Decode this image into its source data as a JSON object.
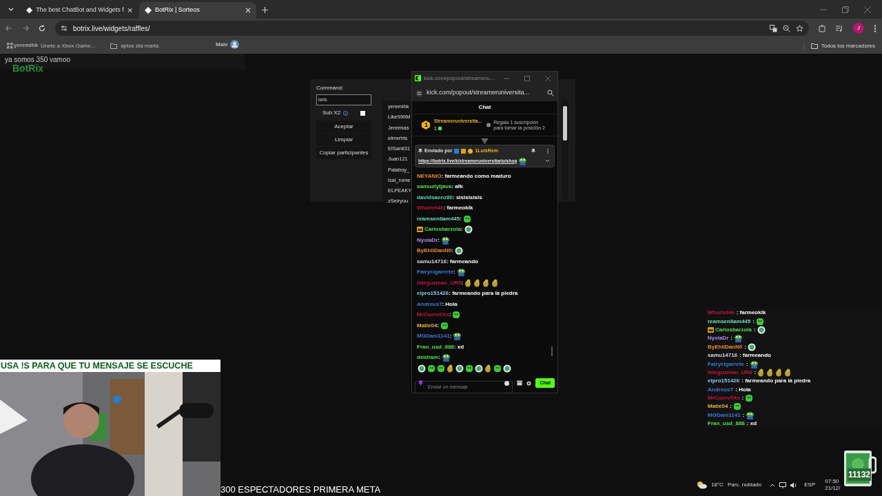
{
  "browser": {
    "tabs": [
      {
        "title": "The best ChatBot and Widgets f",
        "selected": false
      },
      {
        "title": "BotRix | Sorteos",
        "selected": true
      }
    ],
    "url": "botrix.live/widgets/raffles/",
    "profile_initial": "J",
    "bookmarks": [
      "Únete a Xbox Game...",
      "aptos sta marta"
    ],
    "all_bookmarks": "Todos los marcadores"
  },
  "stream_overlay": {
    "alert_user": "yeremihk",
    "alert_name": "Male",
    "chat_line": "ya somos 350 vamoo",
    "logo": "BotRix"
  },
  "raffle": {
    "command_label": "Command:",
    "command_value": "laris",
    "option": {
      "label": "Sub X2",
      "checked": false
    },
    "buttons": [
      "Aceptar",
      "Limpiar",
      "Copiar participantes"
    ],
    "participants": [
      "yeremihk",
      "Like999M",
      "Jeremias",
      "elmxrhts",
      "ElSanti31",
      "Juan121",
      "Palaboy_",
      "isal_rome",
      "ELPEAKY",
      "zSeiryuu"
    ]
  },
  "popout": {
    "window_title": "kick.com/popout/streameru...",
    "url": "kick.com/popout/streameruniversita...",
    "header": "Chat",
    "leader": {
      "name": "Streameruniversita...",
      "rank": "1",
      "count": "1",
      "hint": "Regala 1 suscripción para tomar la posición 2"
    },
    "pinned": {
      "label": "Enviado por",
      "user": "1LuisRem",
      "link": "https://botrix.live/k/streameruniversitario/shop"
    },
    "messages": [
      {
        "user": "NEYANIO",
        "color": "#f08a2c",
        "text": ": farmeando como maduro"
      },
      {
        "user": "samuelytjava",
        "color": "#53e34a",
        "text": ": afk"
      },
      {
        "user": "davidsaenz80",
        "color": "#5fd8a8",
        "text": ": sisisisisis"
      },
      {
        "user": "Whorlet4k",
        "color": "#c8143c",
        "text": ": farmeoklk"
      },
      {
        "user": "reamsenllam445",
        "color": "#6ee0b8",
        "text": ":",
        "emotes": [
          {
            "kind": "blob"
          }
        ]
      },
      {
        "user": "Carlosbarzola",
        "color": "#4fe14a",
        "badge": true,
        "text": ":",
        "emotes": [
          {
            "kind": "robot"
          }
        ]
      },
      {
        "user": "NyxiaDr",
        "color": "#b58cf0",
        "text": ":",
        "emotes": [
          {
            "kind": "frog"
          }
        ]
      },
      {
        "user": "ByEhliDanN0",
        "color": "#f08a2c",
        "text": ":",
        "emotes": [
          {
            "kind": "robot"
          }
        ]
      },
      {
        "user": "samu14716",
        "color": "#d8d8e8",
        "text": ": farmeando"
      },
      {
        "user": "Fairycigarrete",
        "color": "#3c78e0",
        "text": ":",
        "emotes": [
          {
            "kind": "frog"
          }
        ]
      },
      {
        "user": "Ildeguzman_UR8",
        "color": "#c8143c",
        "text": ":",
        "emotes": [
          {
            "kind": "chick"
          },
          {
            "kind": "chick"
          },
          {
            "kind": "chick"
          },
          {
            "kind": "chick"
          }
        ]
      },
      {
        "user": "elpro151426",
        "color": "#8cc8f0",
        "text": ": farmeando para la piedra"
      },
      {
        "user": "AndreusT",
        "color": "#3c78e0",
        "text": ": Hola"
      },
      {
        "user": "MrCuerv0Xx",
        "color": "#c8143c",
        "text": ":",
        "emotes": [
          {
            "kind": "blob"
          }
        ]
      },
      {
        "user": "Matie04",
        "color": "#f0b040",
        "text": ":",
        "emotes": [
          {
            "kind": "blob"
          }
        ]
      },
      {
        "user": "MGDani1141",
        "color": "#3c78e0",
        "text": ":",
        "emotes": [
          {
            "kind": "frog"
          }
        ]
      },
      {
        "user": "Fran_usd_888",
        "color": "#53e34a",
        "text": ": xd"
      },
      {
        "user": "deidram",
        "color": "#53e34a",
        "text": ":",
        "emotes": [
          {
            "kind": "frog"
          }
        ]
      }
    ],
    "input_placeholder": "Enviar un mensaje",
    "send_button": "Chat"
  },
  "overlay_chat": [
    {
      "user": "Whorlet4k",
      "color": "#c8143c",
      "text": ": farmeoklk"
    },
    {
      "user": "reamsenllam445",
      "color": "#6ee0b8",
      "text": ":",
      "emotes": [
        {
          "kind": "blob"
        }
      ]
    },
    {
      "user": "Carlosbarzola",
      "color": "#4fe14a",
      "badge": true,
      "text": ":",
      "emotes": [
        {
          "kind": "robot"
        }
      ]
    },
    {
      "user": "NyxiaDr",
      "color": "#b58cf0",
      "text": ":",
      "emotes": [
        {
          "kind": "frog"
        }
      ]
    },
    {
      "user": "ByEhliDanN0",
      "color": "#f08a2c",
      "text": ":",
      "emotes": [
        {
          "kind": "robot"
        }
      ]
    },
    {
      "user": "samu14716",
      "color": "#d8d8e8",
      "text": ": farmeando"
    },
    {
      "user": "Fairycigarrete",
      "color": "#3c78e0",
      "text": ":",
      "emotes": [
        {
          "kind": "frog"
        }
      ]
    },
    {
      "user": "Ildeguzman_UR8",
      "color": "#c8143c",
      "text": ":",
      "emotes": [
        {
          "kind": "chick"
        },
        {
          "kind": "chick"
        },
        {
          "kind": "chick"
        },
        {
          "kind": "chick"
        }
      ]
    },
    {
      "user": "elpro151426",
      "color": "#8cc8f0",
      "text": ": farmeando para la piedra"
    },
    {
      "user": "AndreusT",
      "color": "#3c78e0",
      "text": ": Hola"
    },
    {
      "user": "MrCuerv0Xx",
      "color": "#c8143c",
      "text": ":",
      "emotes": [
        {
          "kind": "blob"
        }
      ]
    },
    {
      "user": "Matie04",
      "color": "#f0b040",
      "text": ":",
      "emotes": [
        {
          "kind": "blob"
        }
      ]
    },
    {
      "user": "MGDani1141",
      "color": "#3c78e0",
      "text": ":",
      "emotes": [
        {
          "kind": "frog"
        }
      ]
    },
    {
      "user": "Fran_usd_888",
      "color": "#53e34a",
      "text": ": xd"
    }
  ],
  "webcam_banner": "USA !S PARA QUE TU MENSAJE SE ESCUCHE",
  "goal": "300 ESPECTADORES PRIMERA META",
  "taskbar": {
    "temperature": "18°C",
    "weather": "Parc. nublado",
    "language": "ESP",
    "time": "07:50",
    "date": "21/12/"
  },
  "counter": "11132"
}
